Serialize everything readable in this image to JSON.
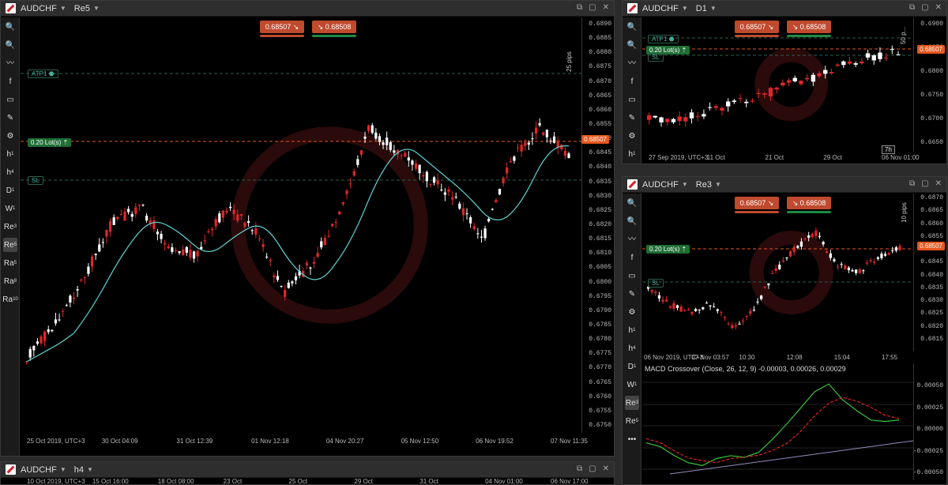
{
  "colors": {
    "bull": "#ffffff",
    "bear": "#e0262b",
    "ma": "#5fd3d3",
    "lot": "#1f6e35",
    "price": "#e7571d",
    "grid": "#1a1a1a"
  },
  "current_price": "0.68507",
  "quote": {
    "sell": "0.68507",
    "buy": "0.68508",
    "sell_arrow": "↘",
    "buy_arrow": "↘"
  },
  "lot_label": "0.20 Lot(s) ⇡",
  "atp_label": "ATP1 ⬣",
  "sl_label": "SL",
  "toolbar_main": [
    {
      "icon": "zoom-in-icon",
      "glyph": "🔍"
    },
    {
      "icon": "zoom-out-icon",
      "glyph": "🔍"
    },
    {
      "icon": "indicator-icon",
      "glyph": "〰"
    },
    {
      "icon": "facebook-icon",
      "glyph": "f"
    },
    {
      "icon": "camera-icon",
      "glyph": "▭"
    },
    {
      "icon": "drawing-icon",
      "glyph": "✎"
    },
    {
      "icon": "settings-icon",
      "glyph": "⚙"
    },
    {
      "icon": "tf-h1",
      "glyph": "h",
      "sub": "1"
    },
    {
      "icon": "tf-h4",
      "glyph": "h",
      "sub": "4"
    },
    {
      "icon": "tf-d1",
      "glyph": "D",
      "sub": "1"
    },
    {
      "icon": "tf-w1",
      "glyph": "W",
      "sub": "1"
    },
    {
      "icon": "tf-re3",
      "glyph": "Re",
      "sub": "3"
    },
    {
      "icon": "tf-re5",
      "glyph": "Re",
      "sub": "5",
      "selected": true
    },
    {
      "icon": "tf-ra5",
      "glyph": "Ra",
      "sub": "5"
    },
    {
      "icon": "tf-ra8",
      "glyph": "Ra",
      "sub": "8"
    },
    {
      "icon": "tf-ra10",
      "glyph": "Ra",
      "sub": "10"
    }
  ],
  "main": {
    "symbol": "AUDCHF",
    "timeframe": "Re5",
    "pips_label": "25 pips",
    "y_ticks": [
      "0.6890",
      "0.6885",
      "0.6880",
      "0.6875",
      "0.6870",
      "0.6865",
      "0.6860",
      "0.6855",
      "0.6850",
      "0.6845",
      "0.6840",
      "0.6835",
      "0.6830",
      "0.6825",
      "0.6820",
      "0.6815",
      "0.6810",
      "0.6805",
      "0.6800",
      "0.6795",
      "0.6790",
      "0.6785",
      "0.6780",
      "0.6775",
      "0.6770",
      "0.6765",
      "0.6760",
      "0.6755",
      "0.6750"
    ],
    "x_labels": [
      "25 Oct 2019, UTC+3",
      "30 Oct 04:09",
      "31 Oct 12:39",
      "01 Nov 12:18",
      "04 Nov 20:27",
      "05 Nov 12:50",
      "06 Nov 19:52",
      "07 Nov 11:35"
    ]
  },
  "d1": {
    "symbol": "AUDCHF",
    "timeframe": "D1",
    "pips_label": "50 p...",
    "y_ticks": [
      "0.6900",
      "0.6850",
      "0.6800",
      "0.6750",
      "0.6700",
      "0.6650"
    ],
    "x_labels": [
      "27 Sep 2019, UTC+3",
      "11 Oct",
      "21 Oct",
      "29 Oct",
      "06 Nov 01:00"
    ],
    "cursor_label": "7h"
  },
  "re3": {
    "symbol": "AUDCHF",
    "timeframe": "Re3",
    "pips_label": "10 pips",
    "y_ticks": [
      "0.6870",
      "0.6865",
      "0.6860",
      "0.6855",
      "0.6850",
      "0.6845",
      "0.6840",
      "0.6835",
      "0.6830",
      "0.6825",
      "0.6820",
      "0.6815"
    ],
    "x_labels": [
      "06 Nov 2019, UTC+3",
      "07 Nov 03:57",
      "10:30",
      "12:08",
      "15:04",
      "17:55"
    ],
    "macd_label": "MACD Crossover (Close, 26, 12, 9) -0.00003, 0.00026, 0.00029",
    "macd_ticks": [
      "0.00050",
      "0.00025",
      "0.00000",
      "-0.00025",
      "-0.00050"
    ]
  },
  "toolbar_re3": [
    {
      "icon": "zoom-in-icon",
      "glyph": "🔍"
    },
    {
      "icon": "zoom-out-icon",
      "glyph": "🔍"
    },
    {
      "icon": "indicator-icon",
      "glyph": "〰"
    },
    {
      "icon": "facebook-icon",
      "glyph": "f"
    },
    {
      "icon": "camera-icon",
      "glyph": "▭"
    },
    {
      "icon": "drawing-icon",
      "glyph": "✎"
    },
    {
      "icon": "settings-icon",
      "glyph": "⚙"
    },
    {
      "icon": "tf-h1",
      "glyph": "h",
      "sub": "1"
    },
    {
      "icon": "tf-h4",
      "glyph": "h",
      "sub": "4"
    },
    {
      "icon": "tf-d1",
      "glyph": "D",
      "sub": "1"
    },
    {
      "icon": "tf-w1",
      "glyph": "W",
      "sub": "1"
    },
    {
      "icon": "tf-re3",
      "glyph": "Re",
      "sub": "3",
      "selected": true
    },
    {
      "icon": "tf-re5",
      "glyph": "Re",
      "sub": "5"
    },
    {
      "icon": "more-icon",
      "glyph": "•••"
    }
  ],
  "h4": {
    "symbol": "AUDCHF",
    "timeframe": "h4",
    "x_labels": [
      "10 Oct 2019, UTC+3",
      "15 Oct 16:00",
      "18 Oct 08:00",
      "23 Oct",
      "25 Oct",
      "29 Oct",
      "31 Oct",
      "04 Nov 01:00",
      "06 Nov 17:00"
    ]
  }
}
